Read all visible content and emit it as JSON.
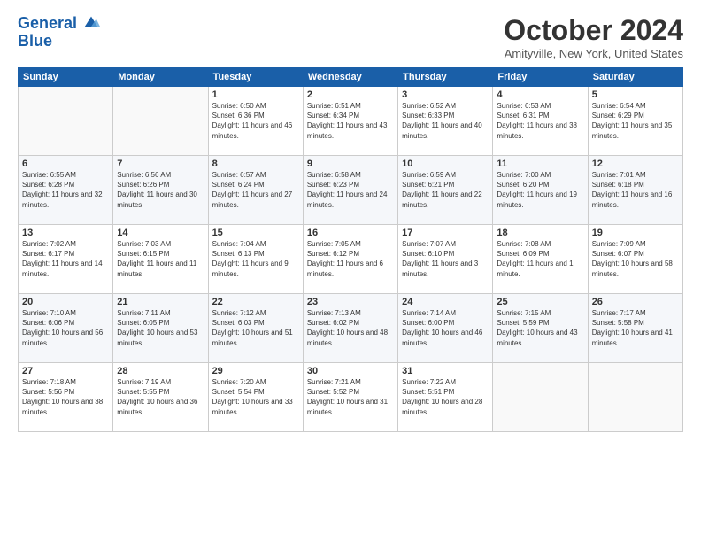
{
  "logo": {
    "line1": "General",
    "line2": "Blue"
  },
  "title": "October 2024",
  "location": "Amityville, New York, United States",
  "weekdays": [
    "Sunday",
    "Monday",
    "Tuesday",
    "Wednesday",
    "Thursday",
    "Friday",
    "Saturday"
  ],
  "weeks": [
    [
      {
        "day": "",
        "detail": ""
      },
      {
        "day": "",
        "detail": ""
      },
      {
        "day": "1",
        "detail": "Sunrise: 6:50 AM\nSunset: 6:36 PM\nDaylight: 11 hours and 46 minutes."
      },
      {
        "day": "2",
        "detail": "Sunrise: 6:51 AM\nSunset: 6:34 PM\nDaylight: 11 hours and 43 minutes."
      },
      {
        "day": "3",
        "detail": "Sunrise: 6:52 AM\nSunset: 6:33 PM\nDaylight: 11 hours and 40 minutes."
      },
      {
        "day": "4",
        "detail": "Sunrise: 6:53 AM\nSunset: 6:31 PM\nDaylight: 11 hours and 38 minutes."
      },
      {
        "day": "5",
        "detail": "Sunrise: 6:54 AM\nSunset: 6:29 PM\nDaylight: 11 hours and 35 minutes."
      }
    ],
    [
      {
        "day": "6",
        "detail": "Sunrise: 6:55 AM\nSunset: 6:28 PM\nDaylight: 11 hours and 32 minutes."
      },
      {
        "day": "7",
        "detail": "Sunrise: 6:56 AM\nSunset: 6:26 PM\nDaylight: 11 hours and 30 minutes."
      },
      {
        "day": "8",
        "detail": "Sunrise: 6:57 AM\nSunset: 6:24 PM\nDaylight: 11 hours and 27 minutes."
      },
      {
        "day": "9",
        "detail": "Sunrise: 6:58 AM\nSunset: 6:23 PM\nDaylight: 11 hours and 24 minutes."
      },
      {
        "day": "10",
        "detail": "Sunrise: 6:59 AM\nSunset: 6:21 PM\nDaylight: 11 hours and 22 minutes."
      },
      {
        "day": "11",
        "detail": "Sunrise: 7:00 AM\nSunset: 6:20 PM\nDaylight: 11 hours and 19 minutes."
      },
      {
        "day": "12",
        "detail": "Sunrise: 7:01 AM\nSunset: 6:18 PM\nDaylight: 11 hours and 16 minutes."
      }
    ],
    [
      {
        "day": "13",
        "detail": "Sunrise: 7:02 AM\nSunset: 6:17 PM\nDaylight: 11 hours and 14 minutes."
      },
      {
        "day": "14",
        "detail": "Sunrise: 7:03 AM\nSunset: 6:15 PM\nDaylight: 11 hours and 11 minutes."
      },
      {
        "day": "15",
        "detail": "Sunrise: 7:04 AM\nSunset: 6:13 PM\nDaylight: 11 hours and 9 minutes."
      },
      {
        "day": "16",
        "detail": "Sunrise: 7:05 AM\nSunset: 6:12 PM\nDaylight: 11 hours and 6 minutes."
      },
      {
        "day": "17",
        "detail": "Sunrise: 7:07 AM\nSunset: 6:10 PM\nDaylight: 11 hours and 3 minutes."
      },
      {
        "day": "18",
        "detail": "Sunrise: 7:08 AM\nSunset: 6:09 PM\nDaylight: 11 hours and 1 minute."
      },
      {
        "day": "19",
        "detail": "Sunrise: 7:09 AM\nSunset: 6:07 PM\nDaylight: 10 hours and 58 minutes."
      }
    ],
    [
      {
        "day": "20",
        "detail": "Sunrise: 7:10 AM\nSunset: 6:06 PM\nDaylight: 10 hours and 56 minutes."
      },
      {
        "day": "21",
        "detail": "Sunrise: 7:11 AM\nSunset: 6:05 PM\nDaylight: 10 hours and 53 minutes."
      },
      {
        "day": "22",
        "detail": "Sunrise: 7:12 AM\nSunset: 6:03 PM\nDaylight: 10 hours and 51 minutes."
      },
      {
        "day": "23",
        "detail": "Sunrise: 7:13 AM\nSunset: 6:02 PM\nDaylight: 10 hours and 48 minutes."
      },
      {
        "day": "24",
        "detail": "Sunrise: 7:14 AM\nSunset: 6:00 PM\nDaylight: 10 hours and 46 minutes."
      },
      {
        "day": "25",
        "detail": "Sunrise: 7:15 AM\nSunset: 5:59 PM\nDaylight: 10 hours and 43 minutes."
      },
      {
        "day": "26",
        "detail": "Sunrise: 7:17 AM\nSunset: 5:58 PM\nDaylight: 10 hours and 41 minutes."
      }
    ],
    [
      {
        "day": "27",
        "detail": "Sunrise: 7:18 AM\nSunset: 5:56 PM\nDaylight: 10 hours and 38 minutes."
      },
      {
        "day": "28",
        "detail": "Sunrise: 7:19 AM\nSunset: 5:55 PM\nDaylight: 10 hours and 36 minutes."
      },
      {
        "day": "29",
        "detail": "Sunrise: 7:20 AM\nSunset: 5:54 PM\nDaylight: 10 hours and 33 minutes."
      },
      {
        "day": "30",
        "detail": "Sunrise: 7:21 AM\nSunset: 5:52 PM\nDaylight: 10 hours and 31 minutes."
      },
      {
        "day": "31",
        "detail": "Sunrise: 7:22 AM\nSunset: 5:51 PM\nDaylight: 10 hours and 28 minutes."
      },
      {
        "day": "",
        "detail": ""
      },
      {
        "day": "",
        "detail": ""
      }
    ]
  ]
}
